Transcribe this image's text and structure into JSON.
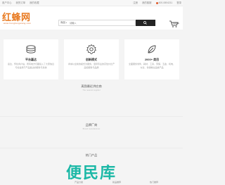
{
  "topbar": {
    "left_links": [
      "用户中心",
      "我的订单",
      "我的收藏"
    ],
    "right_links": [
      "注册",
      "我的客服"
    ],
    "phone": "400-0804211",
    "extra": "登录"
  },
  "header": {
    "logo_text": "红蜂网",
    "logo_sub": "www.hongfengwang.com",
    "search_scope": "商品",
    "search_placeholder": "请输入",
    "cart_label": "购物车"
  },
  "features": [
    {
      "icon": "coins-stack-icon",
      "title": "平台嘉达",
      "desc": "嘉达、传化商户站，所有地方们都投入了大家信息与社会用于产品发达的服务与系统"
    },
    {
      "icon": "gear-icon",
      "title": "创新模式",
      "desc": "商城以全新的模式为服务，坚持专业的高性价比产品和服务与品质"
    },
    {
      "icon": "leaf-pen-icon",
      "title": "2000+ 类目",
      "desc": "全面服务零件、耗材、工具、劳保、五金、机电、仪表、仓储等全品类产品"
    }
  ],
  "sections": {
    "recent": {
      "title": "离我最近供应商",
      "sub": "The nearest supplier"
    },
    "brands": {
      "title": "品牌厂商",
      "sub": "Brand manufacturer"
    },
    "hot": {
      "title": "热门产品",
      "sub": "Hot products"
    }
  },
  "watermark": "便民库",
  "bottom_links": [
    "产品分类",
    "新品推荐",
    "热门推荐"
  ]
}
